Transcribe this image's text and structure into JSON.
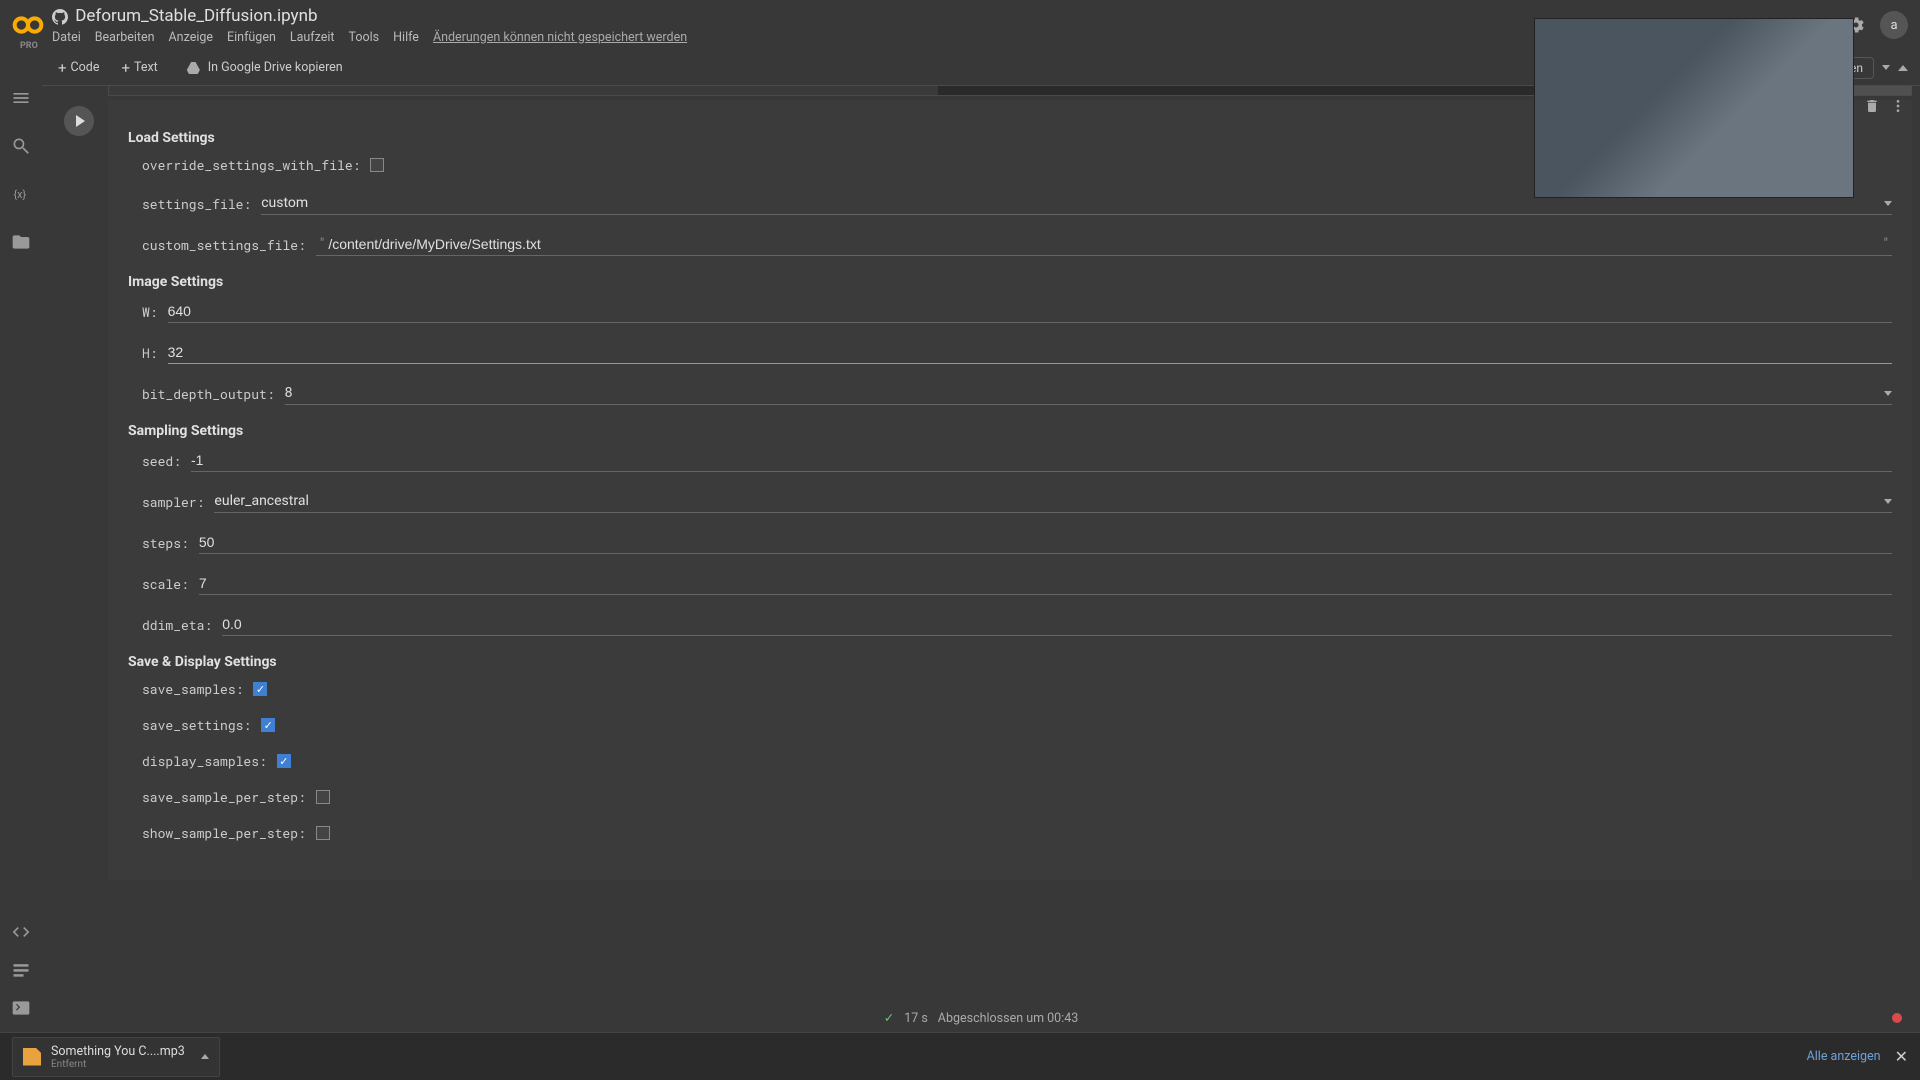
{
  "header": {
    "pro": "PRO",
    "title": "Deforum_Stable_Diffusion.ipynb",
    "menus": [
      "Datei",
      "Bearbeiten",
      "Anzeige",
      "Einfügen",
      "Laufzeit",
      "Tools",
      "Hilfe"
    ],
    "warning": "Änderungen können nicht gespeichert werden",
    "avatar": "a"
  },
  "toolbar": {
    "code": "Code",
    "text": "Text",
    "drive": "In Google Drive kopieren",
    "connect": "en"
  },
  "cell": {
    "load_settings_title": "Load Settings",
    "override_label": "override_settings_with_file:",
    "settings_file_label": "settings_file:",
    "settings_file_value": "custom",
    "custom_settings_file_label": "custom_settings_file:",
    "custom_settings_file_value": "/content/drive/MyDrive/Settings.txt",
    "image_settings_title": "Image Settings",
    "w_label": "W:",
    "w_value": "640",
    "h_label": "H:",
    "h_value": "32",
    "bit_depth_label": "bit_depth_output:",
    "bit_depth_value": "8",
    "sampling_settings_title": "Sampling Settings",
    "seed_label": "seed:",
    "seed_value": "-1",
    "sampler_label": "sampler:",
    "sampler_value": "euler_ancestral",
    "steps_label": "steps:",
    "steps_value": "50",
    "scale_label": "scale:",
    "scale_value": "7",
    "ddim_eta_label": "ddim_eta:",
    "ddim_eta_value": "0.0",
    "save_display_title": "Save & Display Settings",
    "save_samples_label": "save_samples:",
    "save_settings_label": "save_settings:",
    "display_samples_label": "display_samples:",
    "save_sample_per_step_label": "save_sample_per_step:",
    "show_sample_per_step_label": "show_sample_per_step:"
  },
  "status": {
    "time": "17 s",
    "text": "Abgeschlossen um 00:43"
  },
  "downloads": {
    "filename": "Something You C....mp3",
    "status": "Entfernt",
    "show_all": "Alle anzeigen"
  }
}
